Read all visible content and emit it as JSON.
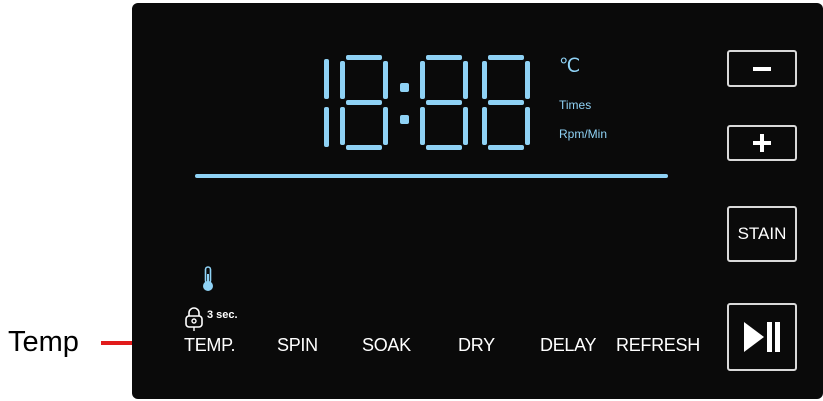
{
  "annotation": {
    "label": "Temp",
    "pointer_color": "#e11b1b"
  },
  "display": {
    "digits": "18:88",
    "units": {
      "celsius": "℃",
      "times": "Times",
      "rpm": "Rpm/Min"
    },
    "color": "#8fd2f5"
  },
  "indicators": {
    "temperature_icon": "thermometer-icon",
    "child_lock_icon": "child-lock-icon",
    "child_lock_hint": "3 sec."
  },
  "functions": [
    {
      "label": "TEMP."
    },
    {
      "label": "SPIN"
    },
    {
      "label": "SOAK"
    },
    {
      "label": "DRY"
    },
    {
      "label": "DELAY"
    },
    {
      "label": "REFRESH"
    }
  ],
  "buttons": {
    "minus": "minus-icon",
    "plus": "plus-icon",
    "stain": "STAIN",
    "start_pause": "play-pause-icon"
  }
}
